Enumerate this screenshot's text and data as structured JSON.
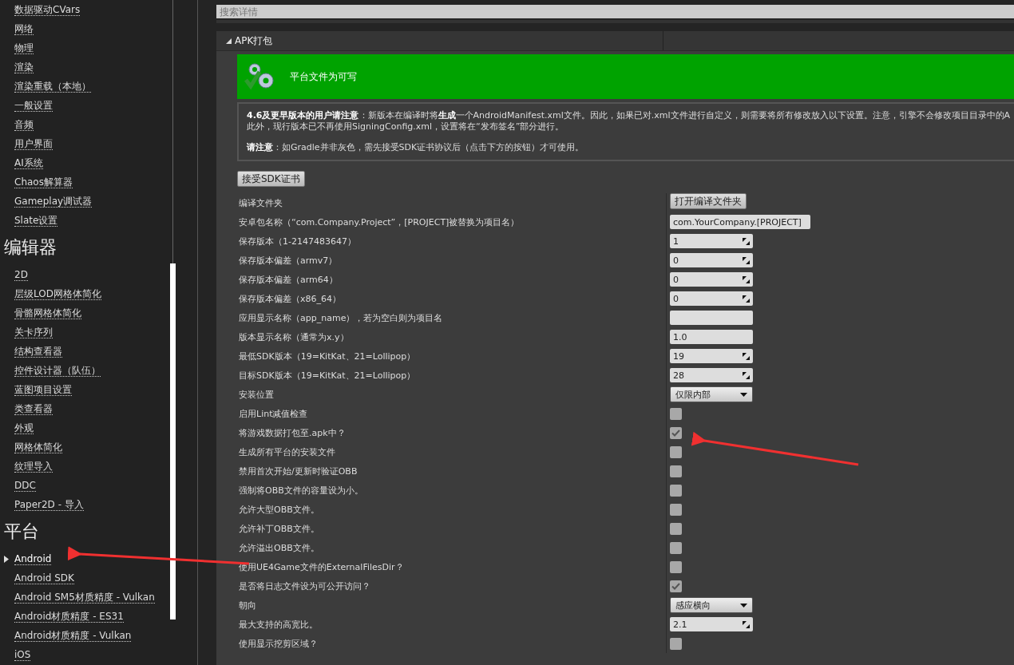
{
  "sidebar": {
    "sections": [
      {
        "items": [
          {
            "label": "数据驱动CVars",
            "selected": false
          },
          {
            "label": "网络",
            "selected": false
          },
          {
            "label": "物理",
            "selected": false
          },
          {
            "label": "渲染",
            "selected": false
          },
          {
            "label": "渲染重载（本地）",
            "selected": false
          },
          {
            "label": "一般设置",
            "selected": false
          },
          {
            "label": "音频",
            "selected": false
          },
          {
            "label": "用户界面",
            "selected": false
          },
          {
            "label": "AI系统",
            "selected": false
          },
          {
            "label": "Chaos解算器",
            "selected": false
          },
          {
            "label": "Gameplay调试器",
            "selected": false
          },
          {
            "label": "Slate设置",
            "selected": false
          }
        ]
      },
      {
        "heading": "编辑器",
        "items": [
          {
            "label": "2D",
            "selected": false
          },
          {
            "label": "层级LOD网格体简化",
            "selected": false
          },
          {
            "label": "骨骼网格体简化",
            "selected": false
          },
          {
            "label": "关卡序列",
            "selected": false
          },
          {
            "label": "结构查看器",
            "selected": false
          },
          {
            "label": "控件设计器（队伍）",
            "selected": false
          },
          {
            "label": "蓝图项目设置",
            "selected": false
          },
          {
            "label": "类查看器",
            "selected": false
          },
          {
            "label": "外观",
            "selected": false
          },
          {
            "label": "网格体简化",
            "selected": false
          },
          {
            "label": "纹理导入",
            "selected": false
          },
          {
            "label": "DDC",
            "selected": false
          },
          {
            "label": "Paper2D - 导入",
            "selected": false
          }
        ]
      },
      {
        "heading": "平台",
        "items": [
          {
            "label": "Android",
            "selected": true
          },
          {
            "label": "Android SDK",
            "selected": false
          },
          {
            "label": "Android SM5材质精度 - Vulkan",
            "selected": false
          },
          {
            "label": "Android材质精度 - ES31",
            "selected": false
          },
          {
            "label": "Android材质精度 - Vulkan",
            "selected": false
          },
          {
            "label": "iOS",
            "selected": false
          }
        ]
      }
    ]
  },
  "search": {
    "placeholder": "搜索详情"
  },
  "section": {
    "title": "APK打包",
    "expanded": true,
    "banner": {
      "text": "平台文件为可写"
    },
    "notes": [
      "**4.6及更早版本的用户请注意**：新版本在编译时将**生成**一个AndroidManifest.xml文件。因此，如果已对.xml文件进行自定义，则需要将所有修改放入以下设置。注意，引擎不会修改项目目录中的A",
      "此外，现行版本已不再使用SigningConfig.xml，设置将在“发布签名”部分进行。",
      "**请注意**：如Gradle并非灰色，需先接受SDK证书协议后（点击下方的按钮）才可使用。"
    ],
    "accept_button": "接受SDK证书",
    "rows": [
      {
        "label": "编译文件夹",
        "kind": "button",
        "value": "打开编译文件夹"
      },
      {
        "label": "安卓包名称（“com.Company.Project”，[PROJECT]被替换为项目名）",
        "kind": "text",
        "value": "com.YourCompany.[PROJECT]"
      },
      {
        "label": "保存版本（1-2147483647）",
        "kind": "number",
        "value": "1"
      },
      {
        "label": "保存版本偏差（armv7）",
        "kind": "number",
        "value": "0"
      },
      {
        "label": "保存版本偏差（arm64）",
        "kind": "number",
        "value": "0"
      },
      {
        "label": "保存版本偏差（x86_64）",
        "kind": "number",
        "value": "0"
      },
      {
        "label": "应用显示名称（app_name），若为空白则为项目名",
        "kind": "text",
        "value": ""
      },
      {
        "label": "版本显示名称（通常为x.y）",
        "kind": "text",
        "value": "1.0"
      },
      {
        "label": "最低SDK版本（19=KitKat、21=Lollipop）",
        "kind": "number",
        "value": "19"
      },
      {
        "label": "目标SDK版本（19=KitKat、21=Lollipop）",
        "kind": "number",
        "value": "28"
      },
      {
        "label": "安装位置",
        "kind": "dropdown",
        "value": "仅限内部"
      },
      {
        "label": "启用Lint减值检查",
        "kind": "checkbox",
        "checked": false
      },
      {
        "label": "将游戏数据打包至.apk中？",
        "kind": "checkbox",
        "checked": true
      },
      {
        "label": "生成所有平台的安装文件",
        "kind": "checkbox",
        "checked": false
      },
      {
        "label": "禁用首次开始/更新时验证OBB",
        "kind": "checkbox",
        "checked": false
      },
      {
        "label": "强制将OBB文件的容量设为小。",
        "kind": "checkbox",
        "checked": false
      },
      {
        "label": "允许大型OBB文件。",
        "kind": "checkbox",
        "checked": false
      },
      {
        "label": "允许补丁OBB文件。",
        "kind": "checkbox",
        "checked": false
      },
      {
        "label": "允许溢出OBB文件。",
        "kind": "checkbox",
        "checked": false
      },
      {
        "label": "使用UE4Game文件的ExternalFilesDir？",
        "kind": "checkbox",
        "checked": false
      },
      {
        "label": "是否将日志文件设为可公开访问？",
        "kind": "checkbox",
        "checked": true
      },
      {
        "label": "朝向",
        "kind": "dropdown",
        "value": "感应横向"
      },
      {
        "label": "最大支持的高宽比。",
        "kind": "number",
        "value": "2.1"
      },
      {
        "label": "使用显示挖剪区域？",
        "kind": "checkbox",
        "checked": false
      }
    ]
  }
}
